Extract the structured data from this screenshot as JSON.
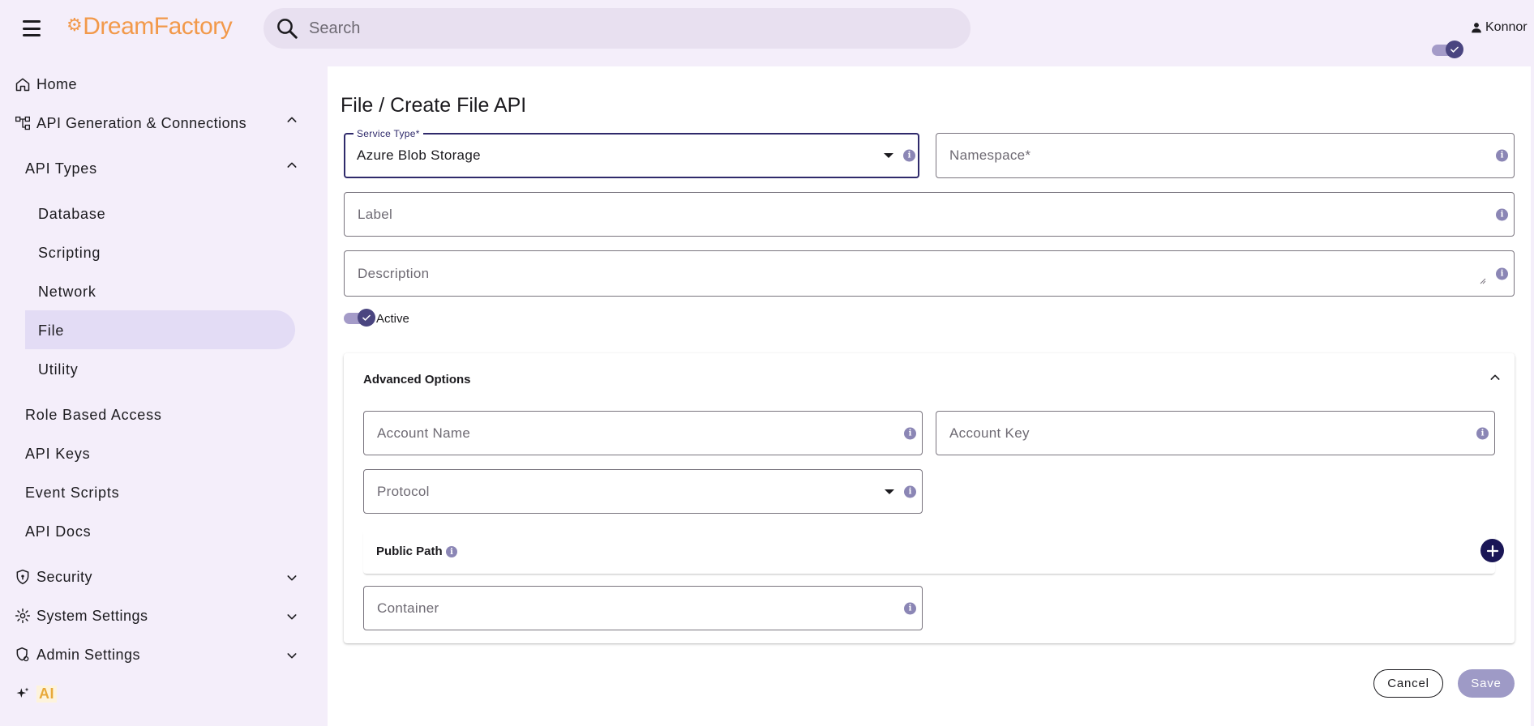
{
  "header": {
    "logo_text": "DreamFactory",
    "search_placeholder": "Search",
    "user_name": "Konnor"
  },
  "sidebar": {
    "home": "Home",
    "api_generation": "API Generation & Connections",
    "api_types": "API Types",
    "api_type_items": [
      "Database",
      "Scripting",
      "Network",
      "File",
      "Utility"
    ],
    "active_item": "File",
    "role_based_access": "Role Based Access",
    "api_keys": "API Keys",
    "event_scripts": "Event Scripts",
    "api_docs": "API Docs",
    "security": "Security",
    "system_settings": "System Settings",
    "admin_settings": "Admin Settings",
    "ai": "AI"
  },
  "main": {
    "title": "File / Create File API",
    "service_type_label": "Service Type*",
    "service_type_value": "Azure Blob Storage",
    "namespace_placeholder": "Namespace*",
    "label_placeholder": "Label",
    "description_placeholder": "Description",
    "active_label": "Active",
    "active_on": true,
    "advanced": {
      "title": "Advanced Options",
      "account_name_placeholder": "Account Name",
      "account_key_placeholder": "Account Key",
      "protocol_placeholder": "Protocol",
      "public_path_label": "Public Path",
      "container_placeholder": "Container"
    },
    "cancel_label": "Cancel",
    "save_label": "Save"
  },
  "colors": {
    "accent": "#2f2a6b",
    "logo": "#f2994a",
    "active_nav_bg": "#e3dcf5",
    "ai_label": "#e8a93a",
    "save_disabled": "#9e9ac6"
  }
}
